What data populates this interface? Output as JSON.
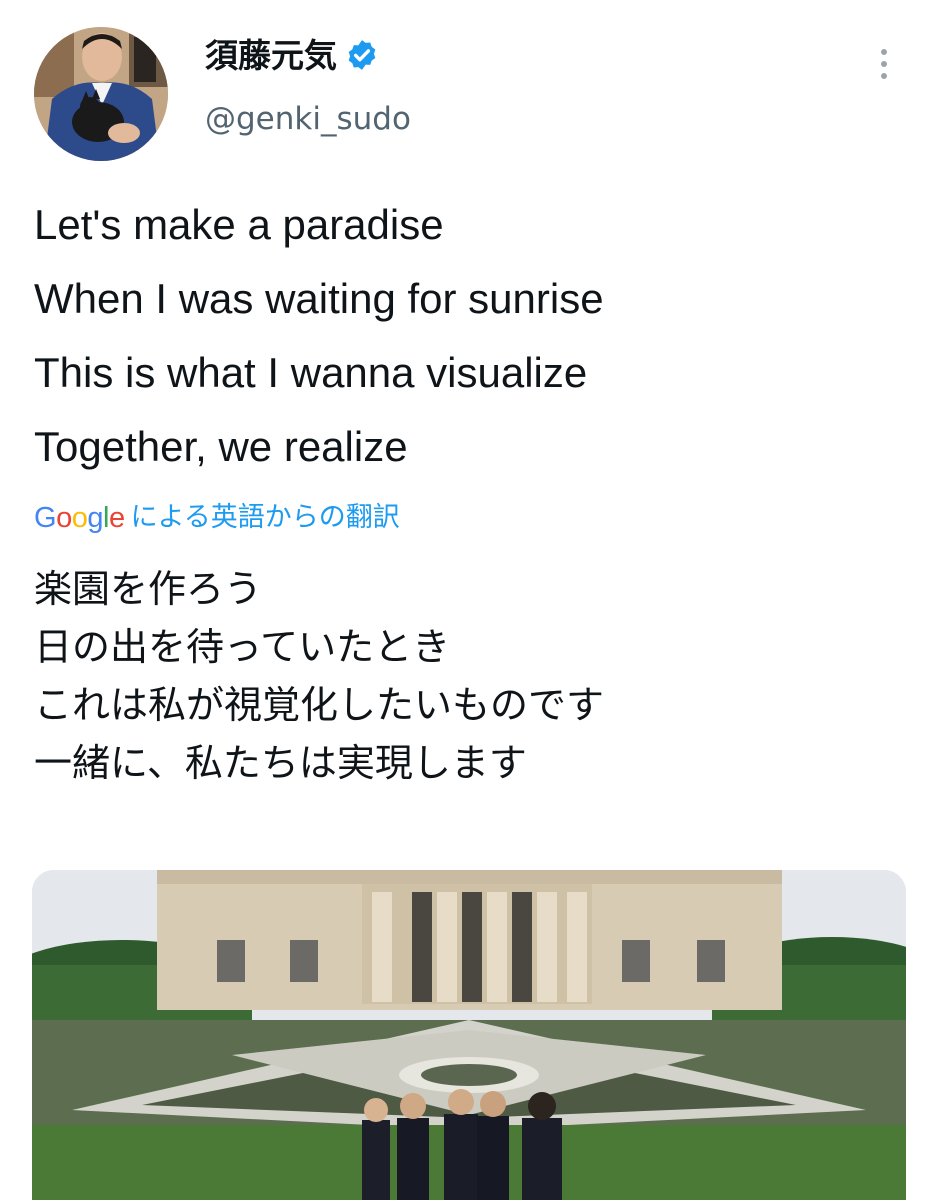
{
  "author": {
    "display_name": "須藤元気",
    "handle": "@genki_sudo",
    "verified": true,
    "avatar_icon": "profile-photo-icon"
  },
  "tweet": {
    "lines": [
      "Let's make a paradise",
      "When I was waiting for sunrise",
      "This is what I wanna visualize",
      "Together, we realize"
    ]
  },
  "translation": {
    "label": "による英語からの翻訳",
    "provider": "Google",
    "lines": [
      "楽園を作ろう",
      "日の出を待っていたとき",
      "これは私が視覚化したいものです",
      "一緒に、私たちは実現します"
    ]
  },
  "media": {
    "icon": "video-thumbnail-icon"
  },
  "colors": {
    "link": "#1d9bf0",
    "secondary_text": "#536471",
    "verified": "#1d9bf0"
  }
}
